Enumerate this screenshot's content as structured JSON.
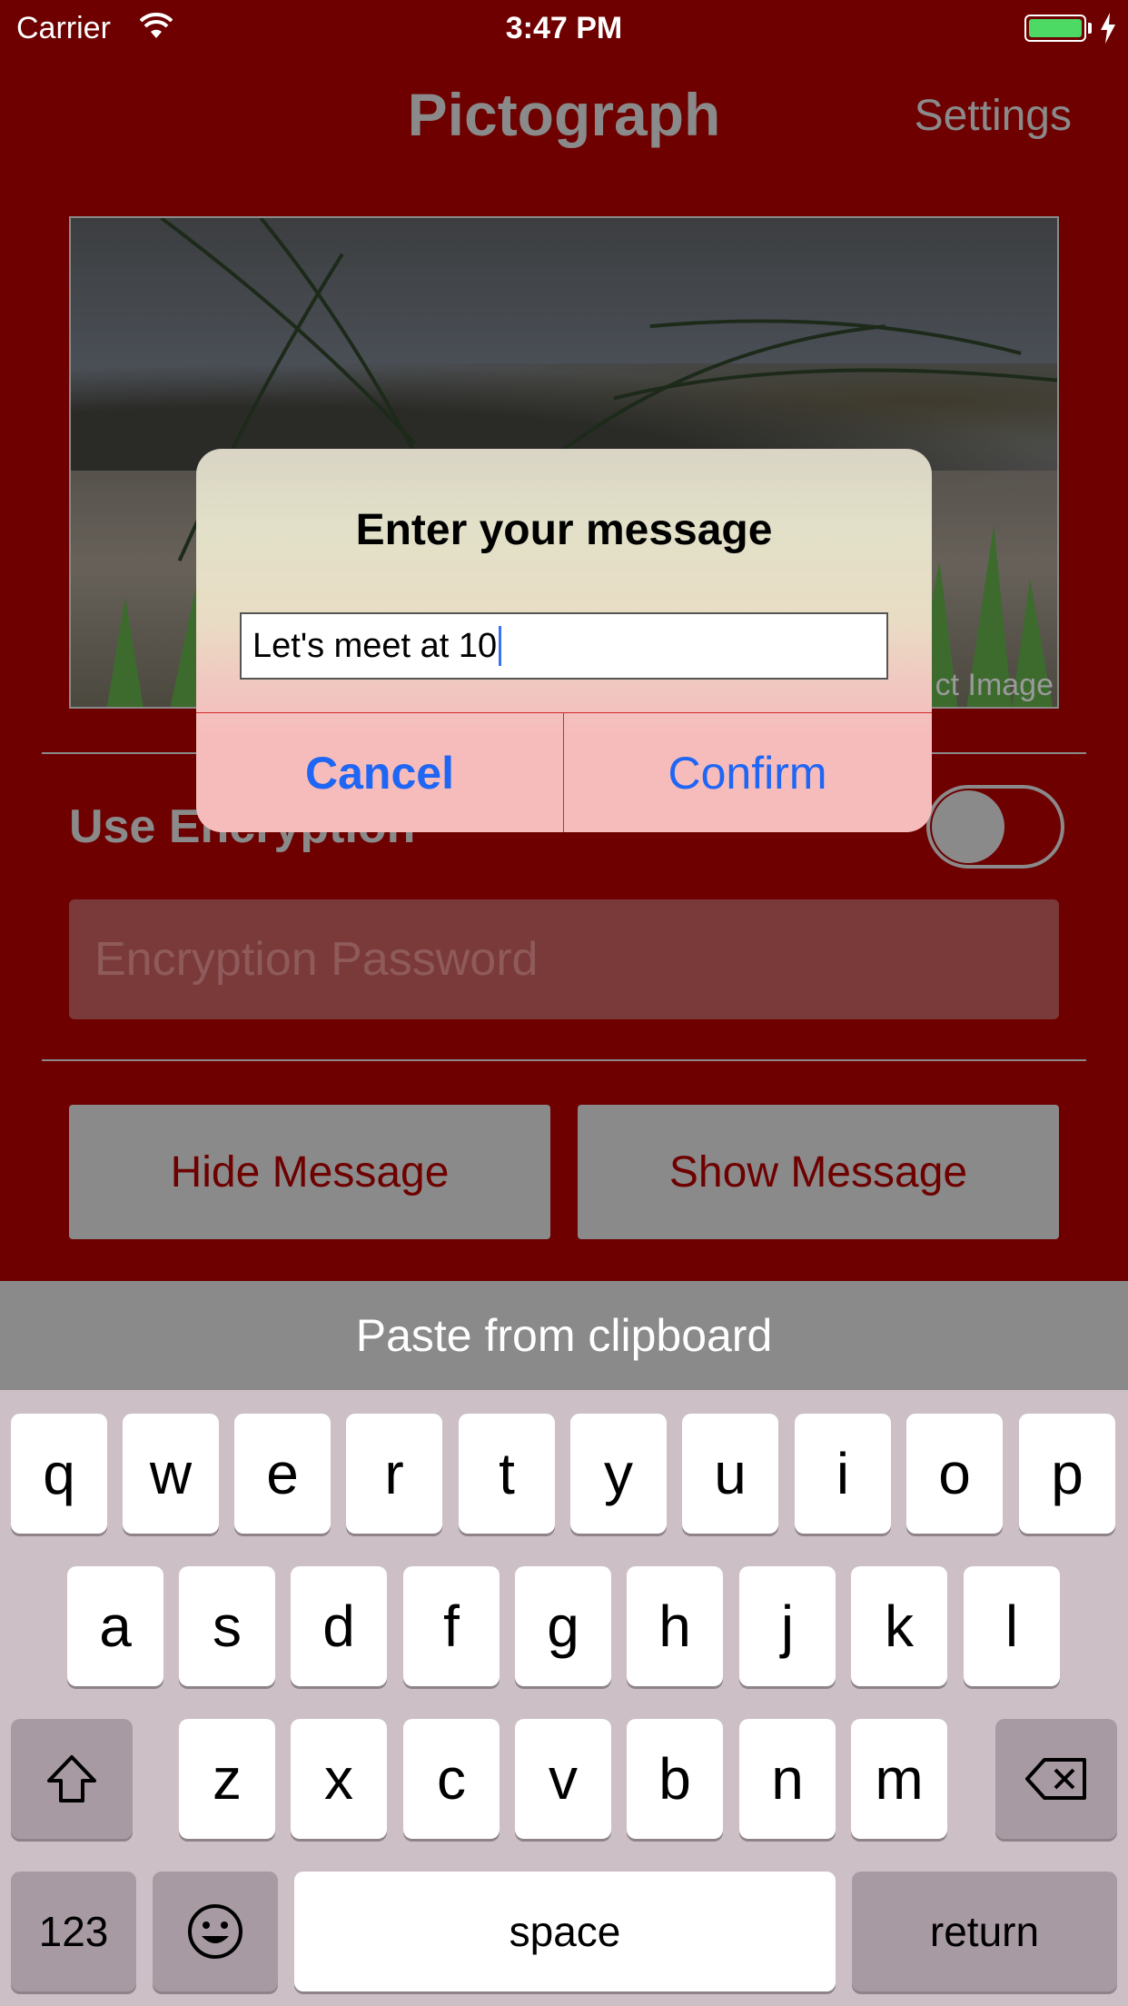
{
  "status_bar": {
    "carrier": "Carrier",
    "time": "3:47 PM",
    "battery_color": "#4cd964"
  },
  "nav": {
    "title": "Pictograph",
    "settings_label": "Settings"
  },
  "image_area": {
    "select_label": "ct Image"
  },
  "encryption": {
    "label": "Use Encryption",
    "toggle_on": false,
    "password_placeholder": "Encryption Password"
  },
  "actions": {
    "hide_label": "Hide Message",
    "show_label": "Show Message"
  },
  "paste_bar": {
    "label": "Paste from clipboard"
  },
  "dialog": {
    "title": "Enter your message",
    "input_value": "Let's meet at 10",
    "cancel_label": "Cancel",
    "confirm_label": "Confirm"
  },
  "keyboard": {
    "row1": [
      "q",
      "w",
      "e",
      "r",
      "t",
      "y",
      "u",
      "i",
      "o",
      "p"
    ],
    "row2": [
      "a",
      "s",
      "d",
      "f",
      "g",
      "h",
      "j",
      "k",
      "l"
    ],
    "row3": [
      "z",
      "x",
      "c",
      "v",
      "b",
      "n",
      "m"
    ],
    "numbers_label": "123",
    "space_label": "space",
    "return_label": "return"
  },
  "colors": {
    "background": "#6e0000",
    "accent_blue": "#1f66f5",
    "muted_gray": "#8a8a8a"
  }
}
